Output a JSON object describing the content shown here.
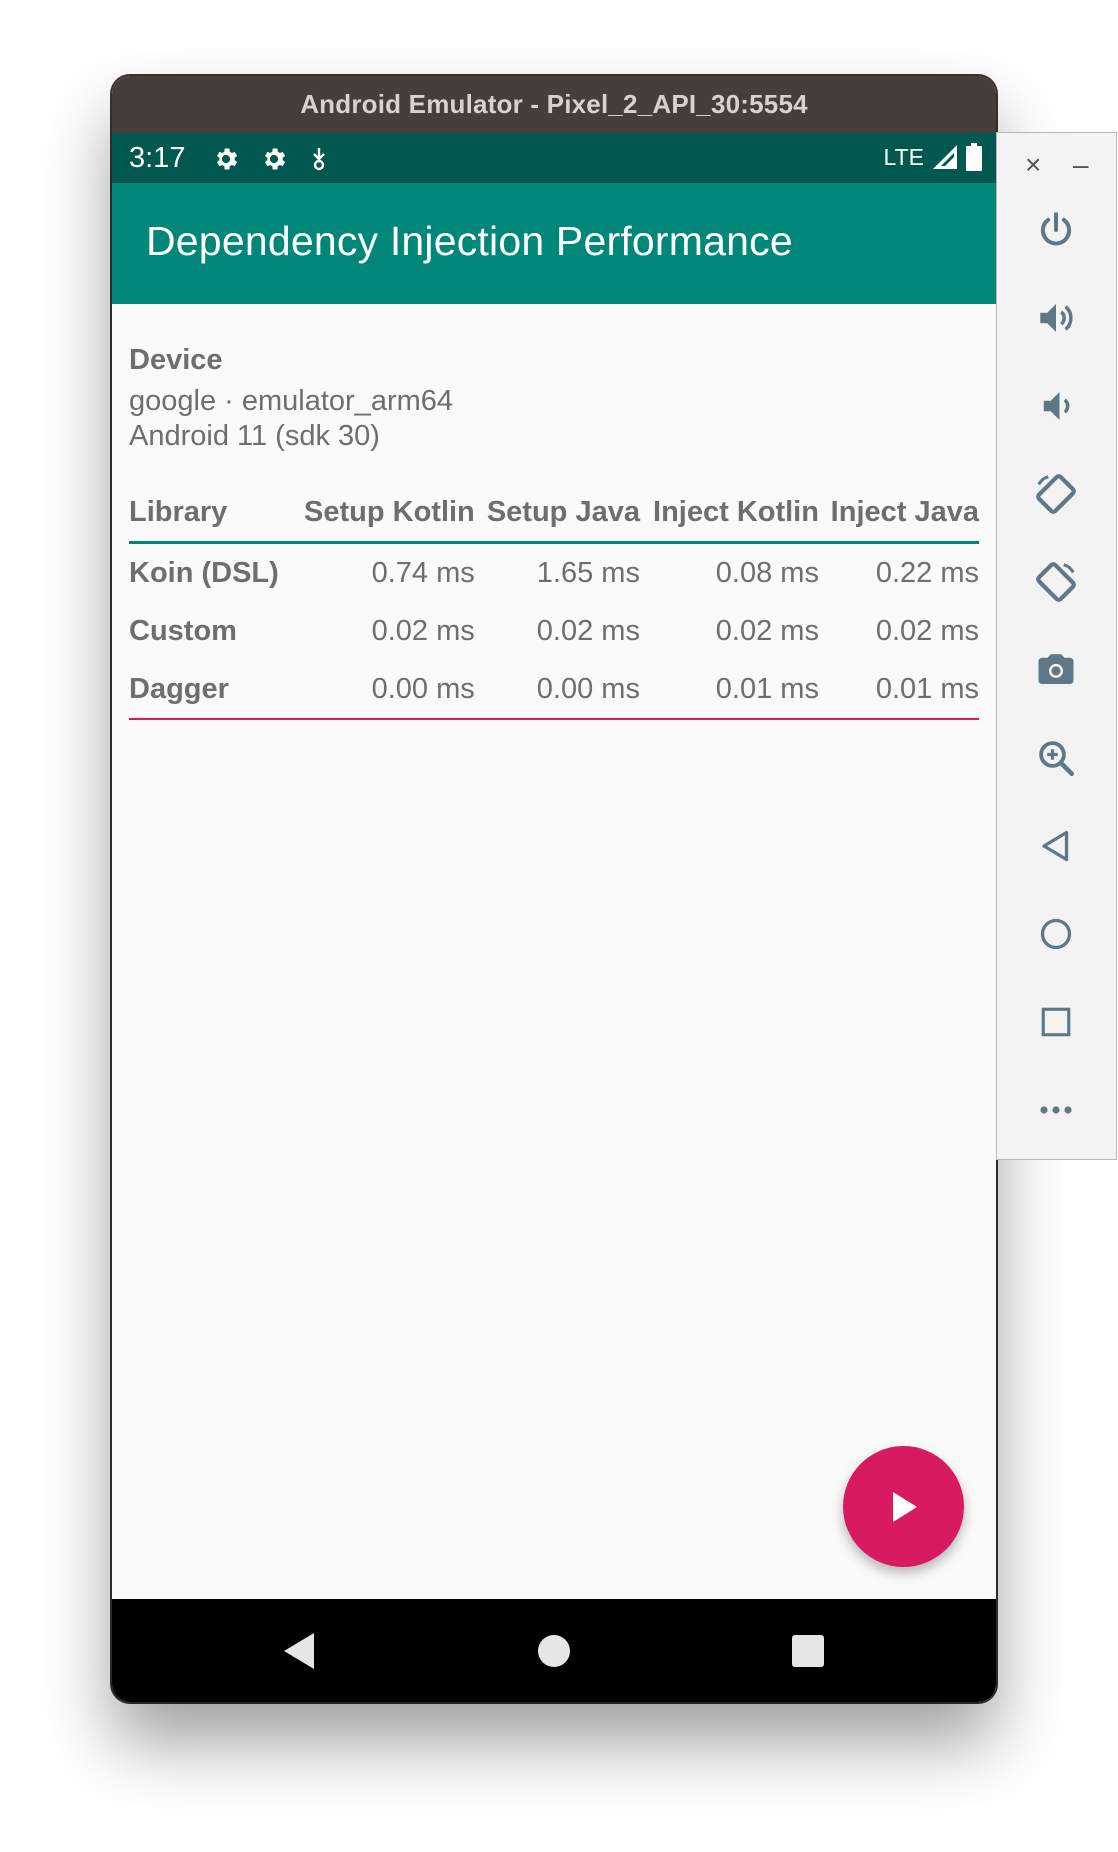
{
  "window": {
    "title": "Android Emulator - Pixel_2_API_30:5554"
  },
  "status_bar": {
    "time": "3:17",
    "network": "LTE",
    "icons": [
      "settings-icon",
      "settings-icon",
      "download-icon",
      "signal-icon",
      "battery-icon"
    ]
  },
  "app_bar": {
    "title": "Dependency Injection Performance"
  },
  "device": {
    "heading": "Device",
    "model": "google · emulator_arm64",
    "os": "Android 11 (sdk 30)"
  },
  "table": {
    "headers": [
      "Library",
      "Setup Kotlin",
      "Setup Java",
      "Inject Kotlin",
      "Inject Java"
    ],
    "rows": [
      [
        "Koin (DSL)",
        "0.74 ms",
        "1.65 ms",
        "0.08 ms",
        "0.22 ms"
      ],
      [
        "Custom",
        "0.02 ms",
        "0.02 ms",
        "0.02 ms",
        "0.02 ms"
      ],
      [
        "Dagger",
        "0.00 ms",
        "0.00 ms",
        "0.01 ms",
        "0.01 ms"
      ]
    ]
  },
  "fab": {
    "icon": "play-icon"
  },
  "nav_bar": {
    "icons": [
      "back-icon",
      "home-icon",
      "recents-icon"
    ]
  },
  "side_panel": {
    "close_glyph": "×",
    "minimize_glyph": "–",
    "tools": [
      "power-icon",
      "volume-up-icon",
      "volume-down-icon",
      "rotate-left-icon",
      "rotate-right-icon",
      "camera-icon",
      "zoom-icon",
      "back-icon",
      "home-icon",
      "overview-icon",
      "more-icon"
    ]
  },
  "colors": {
    "primary": "#00877a",
    "primary_dark": "#00584f",
    "accent": "#d81b60",
    "text_secondary": "#6e6e6e"
  }
}
